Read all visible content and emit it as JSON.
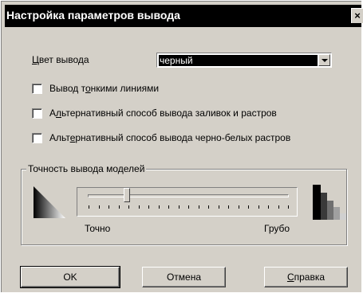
{
  "window": {
    "title": "Настройка параметров вывода",
    "close_glyph": "×"
  },
  "color_output": {
    "label": "Цвет вывода",
    "selected": "черный"
  },
  "checkboxes": [
    {
      "label": "Вывод тонкими линиями",
      "checked": false
    },
    {
      "label": "Альтернативный способ вывода заливок и растров",
      "checked": false
    },
    {
      "label": "Альтернативный способ вывода черно-белых растров",
      "checked": false
    }
  ],
  "precision": {
    "group_label": "Точность вывода моделей",
    "min_label": "Точно",
    "max_label": "Грубо",
    "value": 0.2
  },
  "buttons": {
    "ok": "OK",
    "cancel": "Отмена",
    "help": "Справка"
  },
  "icons": {
    "precise": "gradient-triangle-icon",
    "coarse": "pixel-staircase-icon"
  }
}
